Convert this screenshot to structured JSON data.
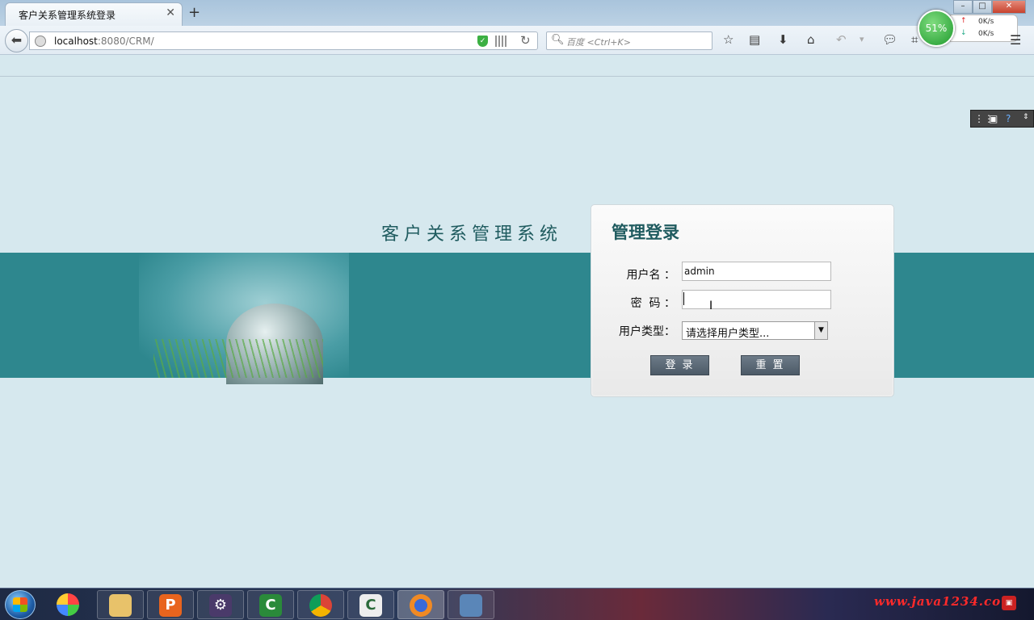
{
  "browser": {
    "tab_title": "客户关系管理系统登录",
    "tab_close": "✕",
    "new_tab": "+",
    "url_host": "localhost",
    "url_path": ":8080/CRM/",
    "search_placeholder": "百度 <Ctrl+K>",
    "win_min": "–",
    "win_max": "□",
    "win_close": "✕",
    "speed": {
      "percent": "51%",
      "up": "0K/s",
      "down": "0K/s"
    }
  },
  "page": {
    "system_title": "客户关系管理系统",
    "login_title": "管理登录",
    "username_label": "用户名 ：",
    "username_value": "admin",
    "password_label": "密  码 ：",
    "usertype_label": "用户类型：",
    "usertype_selected": "请选择用户类型...",
    "login_button": "登录",
    "reset_button": "重置"
  },
  "taskbar": {
    "watermark": "www.java1234.com",
    "items": [
      "P",
      "C",
      "C"
    ]
  },
  "colors": {
    "banner": "#2e878e",
    "page_bg": "#d6e8ee",
    "title_text": "#1f5b5f",
    "button": "#5a6875"
  }
}
